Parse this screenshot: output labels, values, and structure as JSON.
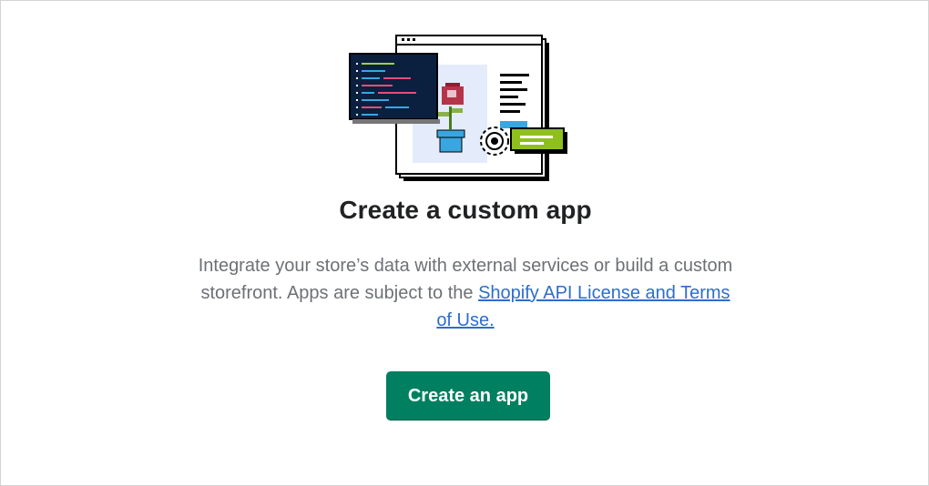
{
  "empty_state": {
    "illustration_icon": "custom-app-illustration",
    "title": "Create a custom app",
    "description_text": "Integrate your store’s data with external services or build a custom storefront. Apps are subject to the ",
    "license_link_label": "Shopify API License and Terms of Use.",
    "create_button_label": "Create an app"
  },
  "colors": {
    "primary_button": "#008060",
    "link": "#2c6ecb",
    "title": "#202223",
    "body_text": "#6d7175"
  }
}
